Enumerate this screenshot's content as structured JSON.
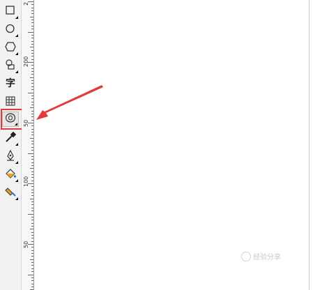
{
  "toolbox": {
    "tools": [
      {
        "name": "rectangle-tool",
        "icon": "rectangle-icon"
      },
      {
        "name": "ellipse-tool",
        "icon": "ellipse-icon"
      },
      {
        "name": "polygon-tool",
        "icon": "polygon-icon"
      },
      {
        "name": "basic-shapes-tool",
        "icon": "basic-shapes-icon"
      },
      {
        "name": "text-tool",
        "icon": "text-icon",
        "glyph": "字"
      },
      {
        "name": "table-tool",
        "icon": "table-icon"
      },
      {
        "name": "contour-tool",
        "icon": "contour-icon",
        "selected": true
      },
      {
        "name": "eyedropper-tool",
        "icon": "eyedropper-icon"
      },
      {
        "name": "outline-pen-tool",
        "icon": "pen-nib-icon"
      },
      {
        "name": "fill-tool",
        "icon": "paint-bucket-icon"
      },
      {
        "name": "interactive-fill-tool",
        "icon": "interactive-fill-icon"
      }
    ]
  },
  "ruler": {
    "labels": [
      "2",
      "200",
      "50",
      "100",
      "50"
    ]
  },
  "annotation": {
    "highlight_color": "#e23b3b",
    "arrow_color": "#e23b3b"
  },
  "watermark": {
    "text": "经验分享"
  }
}
